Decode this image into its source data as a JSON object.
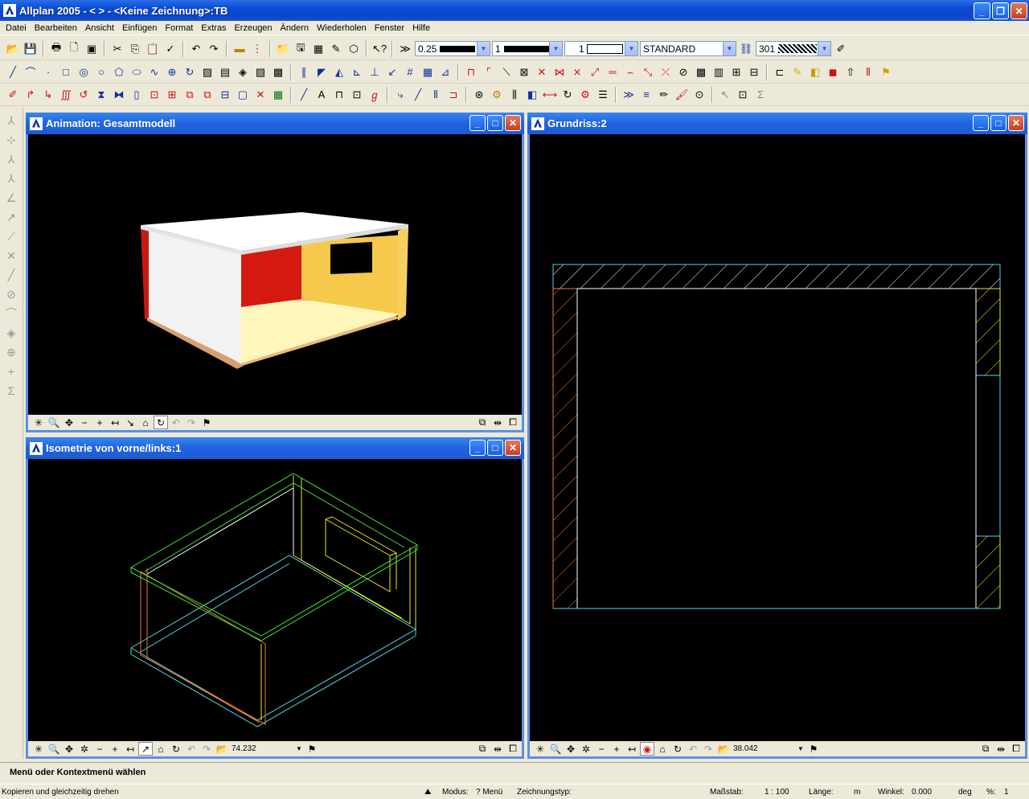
{
  "app": {
    "title": "Allplan 2005 - <        > - <Keine Zeichnung>:TB"
  },
  "menu": [
    "Datei",
    "Bearbeiten",
    "Ansicht",
    "Einfügen",
    "Format",
    "Extras",
    "Erzeugen",
    "Ändern",
    "Wiederholen",
    "Fenster",
    "Hilfe"
  ],
  "toolbar": {
    "pen_thickness": "0.25",
    "line_type": "1",
    "line_color": "1",
    "layer": "STANDARD",
    "hatch": "301"
  },
  "windows": {
    "animation": {
      "title": "Animation: Gesamtmodell"
    },
    "isometrie": {
      "title": "Isometrie von vorne/links:1",
      "scale": "74.232"
    },
    "grundriss": {
      "title": "Grundriss:2",
      "scale": "38.042"
    }
  },
  "prompt": "Menü oder Kontextmenü wählen",
  "status": {
    "hint": "Kopieren und gleichzeitig drehen",
    "modus_label": "Modus:",
    "modus_value": "? Menü",
    "zeichnungstyp_label": "Zeichnungstyp:",
    "massstab_label": "Maßstab:",
    "massstab_value": "1 : 100",
    "laenge_label": "Länge:",
    "laenge_unit": "m",
    "winkel_label": "Winkel:",
    "winkel_value": "0.000",
    "winkel_unit": "deg",
    "percent_label": "%:",
    "percent_value": "1"
  },
  "colors": {
    "title_blue": "#0a4ad6",
    "wall_white": "#f4f4f4",
    "wall_red": "#d01a10",
    "wall_yellow": "#f7c94a",
    "floor": "#fff4b8",
    "cyan": "#4fd8e8",
    "orange": "#f07a30",
    "yellow_line": "#e8e820",
    "green_line": "#40e030"
  }
}
